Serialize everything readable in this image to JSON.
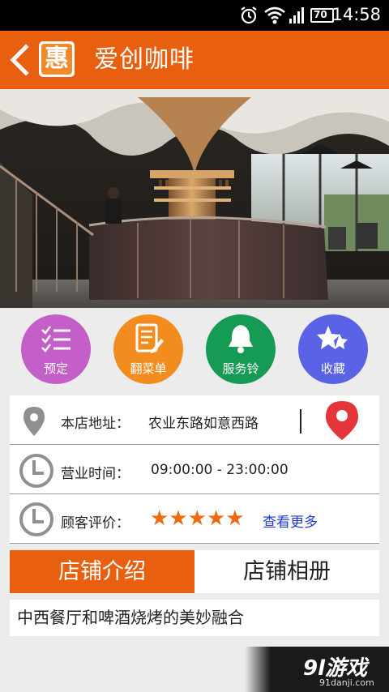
{
  "status_bar": {
    "time": "14:58",
    "battery": "70",
    "icons": [
      "alarm-icon",
      "wifi-icon",
      "signal-icon",
      "battery-icon"
    ]
  },
  "header": {
    "logo_text": "惠",
    "title": "爱创咖啡",
    "accent_color": "#e8600f"
  },
  "actions": [
    {
      "label": "预定",
      "icon": "list-check-icon",
      "color": "#c45fc9"
    },
    {
      "label": "翻菜单",
      "icon": "menu-edit-icon",
      "color": "#f28c1f"
    },
    {
      "label": "服务铃",
      "icon": "bell-icon",
      "color": "#159b54"
    },
    {
      "label": "收藏",
      "icon": "star-icon",
      "color": "#5a63e6"
    }
  ],
  "info": {
    "address_label": "本店地址：",
    "address_value": "农业东路如意西路",
    "hours_label": "营业时间：",
    "hours_value": "09:00:00 - 23:00:00",
    "rating_label": "顾客评价：",
    "rating_stars": 5,
    "more_link": "查看更多"
  },
  "tabs": [
    {
      "label": "店铺介绍",
      "active": true
    },
    {
      "label": "店铺相册",
      "active": false
    }
  ],
  "intro_text": "中西餐厅和啤酒烧烤的美妙融合",
  "watermark": {
    "brand": "9l游戏",
    "url": "91danji.com"
  }
}
